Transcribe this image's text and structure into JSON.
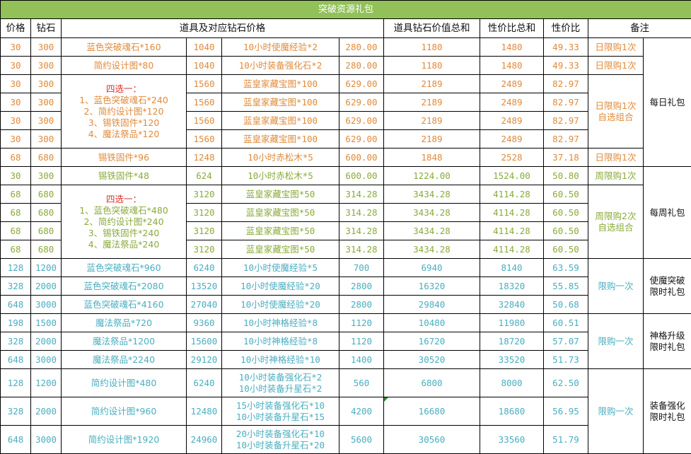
{
  "title": "突破资源礼包",
  "colors": {
    "title_bg": "#92c15a",
    "orange": "#e18a3a",
    "green": "#8aaa3a",
    "teal": "#4aaec0",
    "red": "#e0302c"
  },
  "headers": {
    "price": "价格",
    "diamond": "钻石",
    "items": "道具及对应钻石价格",
    "total_value": "道具钻石价值总和",
    "ratio_total": "性价比总和",
    "ratio": "性价比",
    "note": "备注"
  },
  "rows": [
    {
      "price": "30",
      "diamond": "300",
      "item1": "蓝色突破魂石*160",
      "v1": "1040",
      "item2": "10小时使魔经验*2",
      "v2": "280.00",
      "total": "1180",
      "rtotal": "1480",
      "ratio": "49.33",
      "limit": "日限购1次"
    },
    {
      "price": "30",
      "diamond": "300",
      "item1": "简约设计图*80",
      "v1": "1040",
      "item2": "10小时装备强化石*2",
      "v2": "280.00",
      "total": "1180",
      "rtotal": "1480",
      "ratio": "49.33",
      "limit": "日限购1次"
    },
    {
      "price": "30",
      "diamond": "300",
      "v1": "1560",
      "item2": "蓝皇家藏宝图*100",
      "v2": "629.00",
      "total": "2189",
      "rtotal": "2489",
      "ratio": "82.97"
    },
    {
      "price": "30",
      "diamond": "300",
      "v1": "1560",
      "item2": "蓝皇家藏宝图*100",
      "v2": "629.00",
      "total": "2189",
      "rtotal": "2489",
      "ratio": "82.97"
    },
    {
      "price": "30",
      "diamond": "300",
      "v1": "1560",
      "item2": "蓝皇家藏宝图*100",
      "v2": "629.00",
      "total": "2189",
      "rtotal": "2489",
      "ratio": "82.97"
    },
    {
      "price": "30",
      "diamond": "300",
      "v1": "1560",
      "item2": "蓝皇家藏宝图*100",
      "v2": "629.00",
      "total": "2189",
      "rtotal": "2489",
      "ratio": "82.97"
    },
    {
      "price": "68",
      "diamond": "680",
      "item1": "锡铁固件*96",
      "v1": "1248",
      "item2": "10小时赤松木*5",
      "v2": "600.00",
      "total": "1848",
      "rtotal": "2528",
      "ratio": "37.18",
      "limit": "日限购1次"
    },
    {
      "price": "30",
      "diamond": "300",
      "item1": "锡铁固件*48",
      "v1": "624",
      "item2": "10小时赤松木*5",
      "v2": "600.00",
      "total": "1224.00",
      "rtotal": "1524.00",
      "ratio": "50.80",
      "limit": "周限购1次"
    },
    {
      "price": "68",
      "diamond": "680",
      "v1": "3120",
      "item2": "蓝皇家藏宝图*50",
      "v2": "314.28",
      "total": "3434.28",
      "rtotal": "4114.28",
      "ratio": "60.50"
    },
    {
      "price": "68",
      "diamond": "680",
      "v1": "3120",
      "item2": "蓝皇家藏宝图*50",
      "v2": "314.28",
      "total": "3434.28",
      "rtotal": "4114.28",
      "ratio": "60.50"
    },
    {
      "price": "68",
      "diamond": "680",
      "v1": "3120",
      "item2": "蓝皇家藏宝图*50",
      "v2": "314.28",
      "total": "3434.28",
      "rtotal": "4114.28",
      "ratio": "60.50"
    },
    {
      "price": "68",
      "diamond": "680",
      "v1": "3120",
      "item2": "蓝皇家藏宝图*50",
      "v2": "314.28",
      "total": "3434.28",
      "rtotal": "4114.28",
      "ratio": "60.50"
    },
    {
      "price": "128",
      "diamond": "1200",
      "item1": "蓝色突破魂石*960",
      "v1": "6240",
      "item2": "10小时使魔经验*5",
      "v2": "700",
      "total": "6940",
      "rtotal": "8140",
      "ratio": "63.59"
    },
    {
      "price": "328",
      "diamond": "2000",
      "item1": "蓝色突破魂石*2080",
      "v1": "13520",
      "item2": "10小时使魔经验*20",
      "v2": "2800",
      "total": "16320",
      "rtotal": "18320",
      "ratio": "55.85"
    },
    {
      "price": "648",
      "diamond": "3000",
      "item1": "蓝色突破魂石*4160",
      "v1": "27040",
      "item2": "10小时使魔经验*20",
      "v2": "2800",
      "total": "29840",
      "rtotal": "32840",
      "ratio": "50.68"
    },
    {
      "price": "198",
      "diamond": "1500",
      "item1": "魔法祭品*720",
      "v1": "9360",
      "item2": "10小时神格经验*8",
      "v2": "1120",
      "total": "10480",
      "rtotal": "11980",
      "ratio": "60.51"
    },
    {
      "price": "328",
      "diamond": "2000",
      "item1": "魔法祭品*1200",
      "v1": "15600",
      "item2": "10小时神格经验*8",
      "v2": "1120",
      "total": "16720",
      "rtotal": "18720",
      "ratio": "57.07"
    },
    {
      "price": "648",
      "diamond": "3000",
      "item1": "魔法祭品*2240",
      "v1": "29120",
      "item2": "10小时神格经验*10",
      "v2": "1400",
      "total": "30520",
      "rtotal": "33520",
      "ratio": "51.73"
    },
    {
      "price": "128",
      "diamond": "1200",
      "item1": "简约设计图*480",
      "v1": "6240",
      "item2a": "10小时装备强化石*2",
      "item2b": "10小时装备升星石*2",
      "v2": "560",
      "total": "6800",
      "rtotal": "8000",
      "ratio": "62.50"
    },
    {
      "price": "328",
      "diamond": "2000",
      "item1": "简约设计图*960",
      "v1": "12480",
      "item2a": "15小时装备强化石*10",
      "item2b": "10小时装备升星石*15",
      "v2": "4200",
      "total": "16680",
      "rtotal": "18680",
      "ratio": "56.95"
    },
    {
      "price": "648",
      "diamond": "3000",
      "item1": "简约设计图*1920",
      "v1": "24960",
      "item2a": "20小时装备强化石*10",
      "item2b": "10小时装备升星石*20",
      "v2": "5600",
      "total": "30560",
      "rtotal": "33560",
      "ratio": "51.79"
    }
  ],
  "choice_daily": {
    "heading": "四选一：",
    "lines": [
      "1、蓝色突破魂石*240",
      "2、简约设计图*120",
      "3、锡铁固件*120",
      "4、魔法祭品*120"
    ]
  },
  "choice_weekly": {
    "heading": "四选一：",
    "lines": [
      "1、蓝色突破魂石*480",
      "2、简约设计图*240",
      "3、锡铁固件*240",
      "4、魔法祭品*240"
    ]
  },
  "limits": {
    "daily_choice_a": "日限购1次",
    "daily_choice_b": "自选组合",
    "weekly_choice_a": "周限购2次",
    "weekly_choice_b": "自选组合",
    "once": "限购一次"
  },
  "notes": {
    "daily": "每日礼包",
    "weekly": "每周礼包",
    "familiar_a": "使魔突破",
    "familiar_b": "限时礼包",
    "divine_a": "神格升级",
    "divine_b": "限时礼包",
    "equip_a": "装备强化",
    "equip_b": "限时礼包"
  }
}
